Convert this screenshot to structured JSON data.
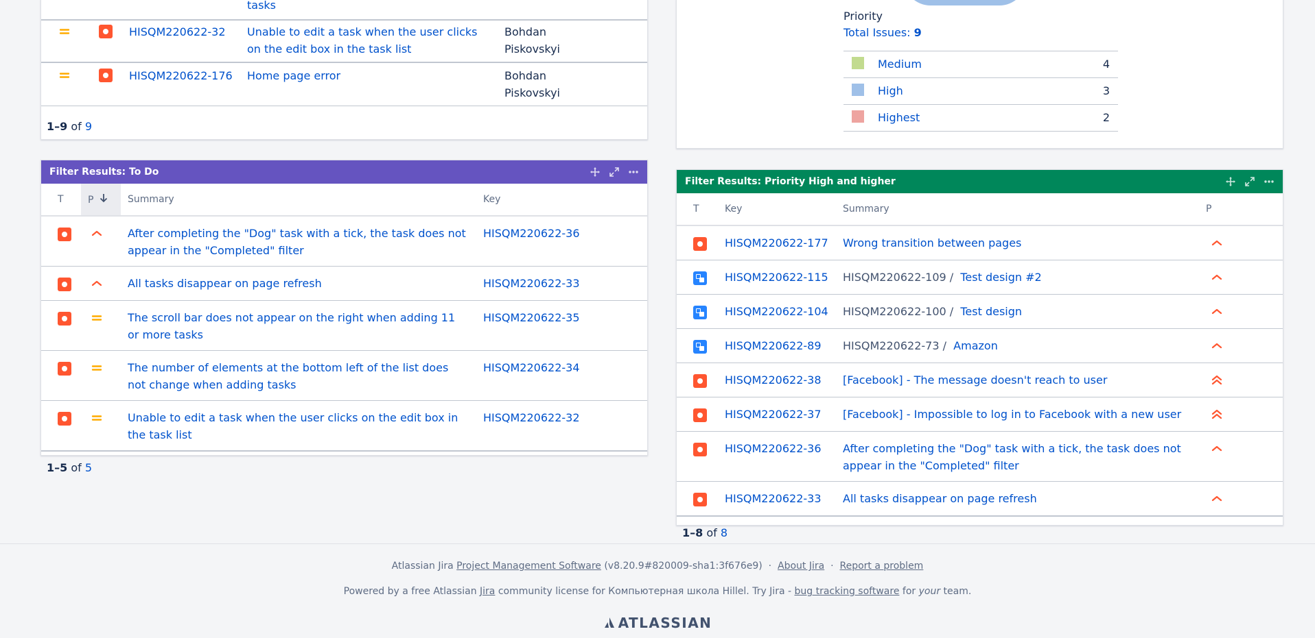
{
  "top_left": {
    "partial_summary": "tasks",
    "rows": [
      {
        "key": "HISQM220622-32",
        "summary": "Unable to edit a task when the user clicks on the edit box in the task list",
        "assignee": "Bohdan Piskovskyi"
      },
      {
        "key": "HISQM220622-176",
        "summary": "Home page error",
        "assignee": "Bohdan Piskovskyi"
      }
    ],
    "pager": {
      "range": "1–9",
      "of": "of",
      "total": "9"
    }
  },
  "pie": {
    "label": "Priority",
    "total_label": "Total Issues:",
    "total": "9",
    "legend": [
      {
        "name": "Medium",
        "count": "4",
        "color": "#c2db8f"
      },
      {
        "name": "High",
        "count": "3",
        "color": "#9fc0e8"
      },
      {
        "name": "Highest",
        "count": "2",
        "color": "#eea4a0"
      }
    ]
  },
  "todo": {
    "title": "Filter Results: To Do",
    "color": "#6554c0",
    "headers": {
      "t": "T",
      "p": "P",
      "summary": "Summary",
      "key": "Key"
    },
    "rows": [
      {
        "summary": "After completing the \"Dog\" task with a tick, the task does not appear in the \"Completed\" filter",
        "key": "HISQM220622-36",
        "priority": "high"
      },
      {
        "summary": "All tasks disappear on page refresh",
        "key": "HISQM220622-33",
        "priority": "high"
      },
      {
        "summary": "The scroll bar does not appear on the right when adding 11 or more tasks",
        "key": "HISQM220622-35",
        "priority": "medium"
      },
      {
        "summary": "The number of elements at the bottom left of the list does not change when adding tasks",
        "key": "HISQM220622-34",
        "priority": "medium"
      },
      {
        "summary": "Unable to edit a task when the user clicks on the edit box in the task list",
        "key": "HISQM220622-32",
        "priority": "medium"
      }
    ],
    "pager": {
      "range": "1–5",
      "of": "of",
      "total": "5"
    }
  },
  "high": {
    "title": "Filter Results: Priority High and higher",
    "color": "#00875a",
    "headers": {
      "t": "T",
      "key": "Key",
      "summary": "Summary",
      "p": "P"
    },
    "rows": [
      {
        "type": "bug",
        "key": "HISQM220622-177",
        "parent": "",
        "summary": "Wrong transition between pages",
        "priority": "high"
      },
      {
        "type": "sub",
        "key": "HISQM220622-115",
        "parent": "HISQM220622-109 /",
        "summary": "Test design #2",
        "priority": "high"
      },
      {
        "type": "sub",
        "key": "HISQM220622-104",
        "parent": "HISQM220622-100 /",
        "summary": "Test design",
        "priority": "high"
      },
      {
        "type": "sub",
        "key": "HISQM220622-89",
        "parent": "HISQM220622-73 /",
        "summary": "Amazon",
        "priority": "high"
      },
      {
        "type": "bug",
        "key": "HISQM220622-38",
        "parent": "",
        "summary": "[Facebook] - The message doesn't reach to user",
        "priority": "highest"
      },
      {
        "type": "bug",
        "key": "HISQM220622-37",
        "parent": "",
        "summary": "[Facebook] - Impossible to log in to Facebook with a new user",
        "priority": "highest"
      },
      {
        "type": "bug",
        "key": "HISQM220622-36",
        "parent": "",
        "summary": "After completing the \"Dog\" task with a tick, the task does not appear in the \"Completed\" filter",
        "priority": "high"
      },
      {
        "type": "bug",
        "key": "HISQM220622-33",
        "parent": "",
        "summary": "All tasks disappear on page refresh",
        "priority": "high"
      }
    ],
    "pager": {
      "range": "1–8",
      "of": "of",
      "total": "8"
    }
  },
  "footer": {
    "line1_prefix": "Atlassian Jira",
    "pm_link": "Project Management Software",
    "version": "(v8.20.9#820009-sha1:3f676e9)",
    "sep": "·",
    "about": "About Jira",
    "report": "Report a problem",
    "line2_a": "Powered by a free Atlassian",
    "jira_link": "Jira",
    "line2_b": "community license for Компьютерная школа Hillel. Try Jira -",
    "bug_link": "bug tracking software",
    "line2_c": "for",
    "your": "your",
    "line2_d": "team.",
    "logo": "ATLASSIAN"
  }
}
